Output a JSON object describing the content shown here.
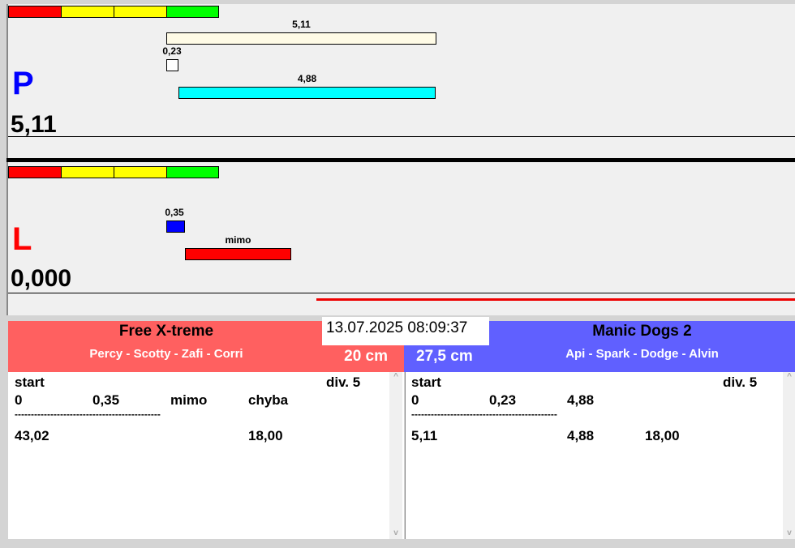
{
  "colors": {
    "left_team": "#ff6060",
    "right_team": "#6060ff",
    "p_letter": "#0000ff",
    "l_letter": "#ff0000"
  },
  "p_panel": {
    "letter": "P",
    "value": "5,11",
    "bars": [
      {
        "label": "5,11"
      },
      {
        "label": "0,23"
      },
      {
        "label": "4,88"
      }
    ]
  },
  "l_panel": {
    "letter": "L",
    "value": "0,000",
    "bars": [
      {
        "label": "0,35"
      },
      {
        "label": "mimo"
      }
    ]
  },
  "datetime": "13.07.2025 08:09:37",
  "left": {
    "team": "Free X-treme",
    "dogs": "Percy - Scotty - Zafi - Corri",
    "height": "20 cm",
    "rows": {
      "start": "start",
      "div": "div.  5",
      "c1": "0",
      "c2": "0,35",
      "c3": "mimo",
      "c4": "chyba",
      "sep": "---------------------------------------------",
      "t1": "43,02",
      "t4": "18,00"
    }
  },
  "right": {
    "team": "Manic Dogs 2",
    "dogs": "Api - Spark - Dodge - Alvin",
    "height": "27,5 cm",
    "rows": {
      "start": "start",
      "div": "div.  5",
      "c1": "0",
      "c2": "0,23",
      "c3": "4,88",
      "sep": "---------------------------------------------",
      "t1": "5,11",
      "t3": "4,88",
      "t4": "18,00"
    }
  },
  "scroll": {
    "up": "^",
    "down": "v"
  }
}
